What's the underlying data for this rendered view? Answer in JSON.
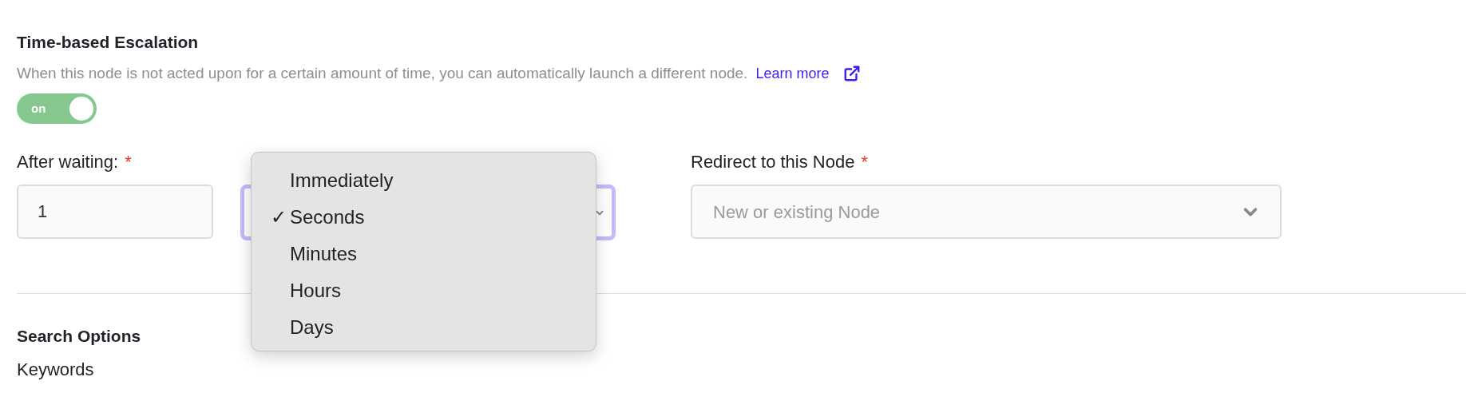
{
  "escalation": {
    "title": "Time-based Escalation",
    "description": "When this node is not acted upon for a certain amount of time, you can automatically launch a different node.",
    "link": "Learn more",
    "toggle": {
      "label": "on",
      "on": true
    }
  },
  "wait": {
    "label": "After waiting:",
    "required_mark": "*",
    "value": "1"
  },
  "unit_menu": {
    "check": "✓",
    "options": [
      {
        "label": "Immediately",
        "selected": false
      },
      {
        "label": "Seconds",
        "selected": true
      },
      {
        "label": "Minutes",
        "selected": false
      },
      {
        "label": "Hours",
        "selected": false
      },
      {
        "label": "Days",
        "selected": false
      }
    ]
  },
  "redirect": {
    "label": "Redirect to this Node",
    "required_mark": "*",
    "placeholder": "New or existing Node"
  },
  "search_options": {
    "title": "Search Options",
    "label": "Keywords"
  }
}
